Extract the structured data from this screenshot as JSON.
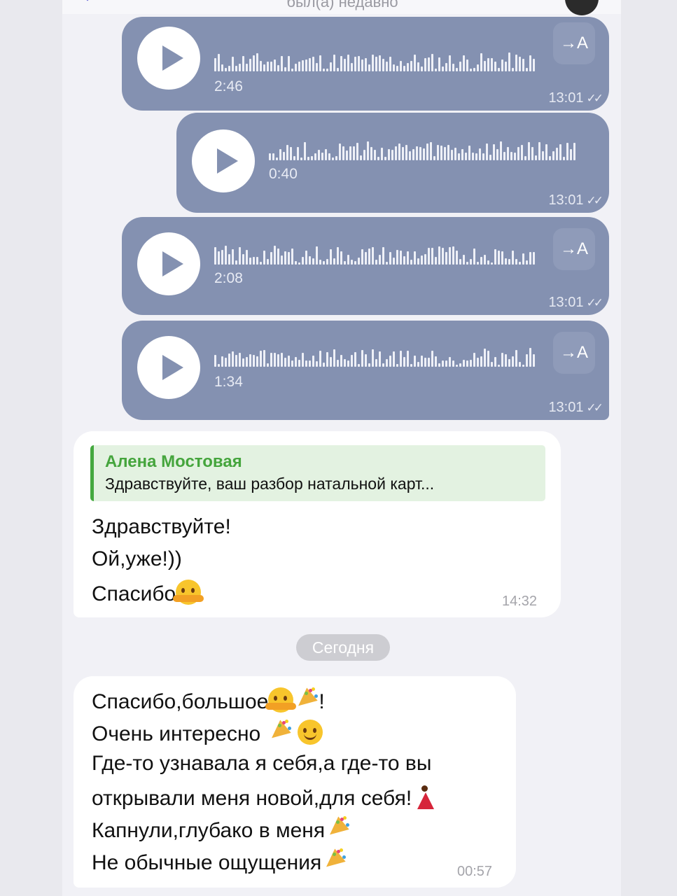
{
  "header": {
    "status": "был(а) недавно"
  },
  "voice_messages": [
    {
      "duration": "2:46",
      "time": "13:01",
      "translate_label": "→A"
    },
    {
      "duration": "0:40",
      "time": "13:01"
    },
    {
      "duration": "2:08",
      "time": "13:01",
      "translate_label": "→A"
    },
    {
      "duration": "1:34",
      "time": "13:01",
      "translate_label": "→A"
    }
  ],
  "read_check": "✓✓",
  "incoming_1": {
    "reply_author": "Алена Мостовая",
    "reply_text": "Здравствуйте, ваш разбор натальной карт...",
    "lines": [
      "Здравствуйте!",
      "Ой,уже!))",
      "Спасибо"
    ],
    "time": "14:32"
  },
  "date_divider": "Сегодня",
  "incoming_2": {
    "lines": [
      "Спасибо,большое",
      "!",
      "Очень интересно",
      "Где-то узнавала я себя,а где-то вы",
      "открывали меня новой,для себя!",
      "Капнули,глубако в меня",
      "Не обычные ощущения"
    ],
    "time": "00:57"
  },
  "icons": {
    "voice_play": "play-icon",
    "translate": "translate-icon",
    "emoji_hug": "hugging-face-emoji",
    "emoji_party": "party-popper-emoji",
    "emoji_smile": "smiling-face-emoji",
    "emoji_dancer": "dancer-emoji"
  },
  "colors": {
    "voice_bubble": "#8491b1",
    "reply_accent": "#44a83f",
    "date_pill": "#cdcdd2",
    "incoming_bubble": "#ffffff"
  }
}
